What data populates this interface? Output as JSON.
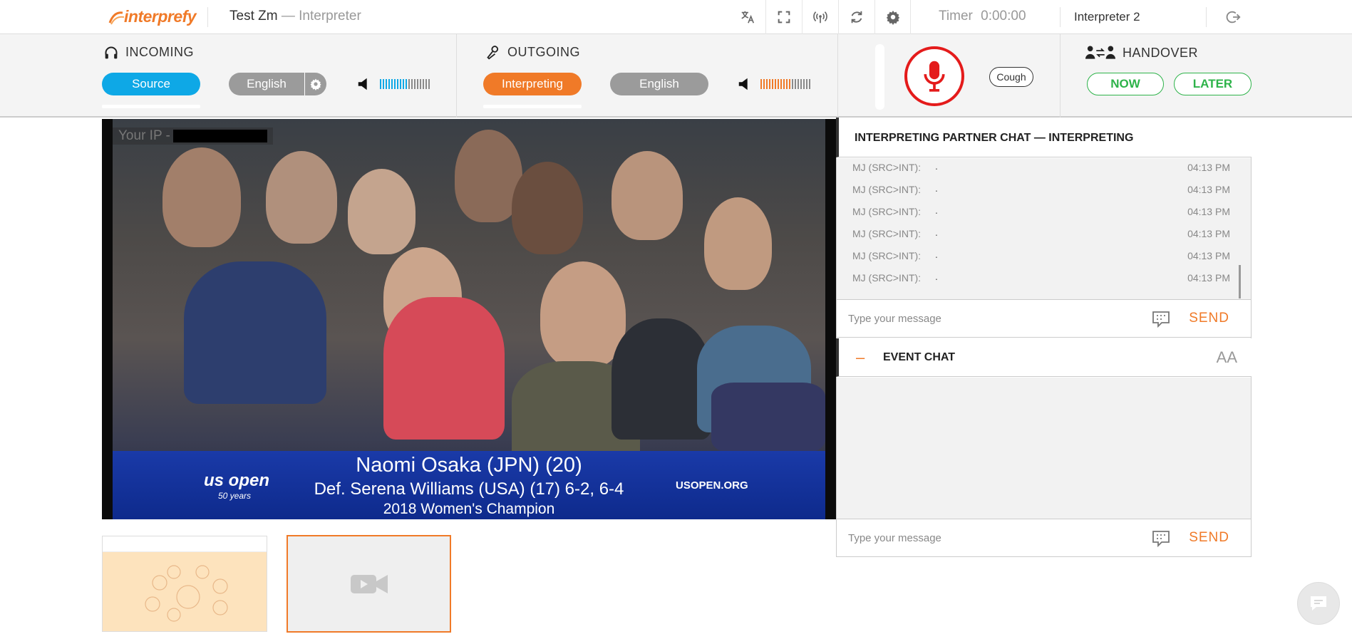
{
  "app": {
    "brand": "interprefy",
    "title": "Test Zm",
    "subtitle": "— Interpreter",
    "timer_label": "Timer",
    "timer_value": "0:00:00",
    "user": "Interpreter 2"
  },
  "toolbar": {
    "icons": [
      "translate-icon",
      "fullscreen-icon",
      "broadcast-icon",
      "refresh-icon",
      "gear-icon"
    ],
    "logout_icon": "logout-icon"
  },
  "incoming": {
    "title": "INCOMING",
    "source_label": "Source",
    "language": "English",
    "meter_level": 0.55
  },
  "outgoing": {
    "title": "OUTGOING",
    "interpreting_label": "Interpreting",
    "language": "English",
    "meter_level": 0.62
  },
  "controls": {
    "cough_label": "Cough"
  },
  "handover": {
    "title": "HANDOVER",
    "now_label": "NOW",
    "later_label": "LATER"
  },
  "video": {
    "ip_label": "Your IP -",
    "caption_line1": "Naomi Osaka (JPN) (20)",
    "caption_line2": "Def. Serena Williams (USA) (17) 6-2, 6-4",
    "caption_line3": "2018 Women's Champion",
    "brand_logo": "us open",
    "brand_years": "50 years",
    "site": "USOPEN.ORG"
  },
  "partner_chat": {
    "title": "INTERPRETING PARTNER CHAT — INTERPRETING",
    "messages": [
      {
        "sender": "MJ (SRC>INT):",
        "text": ".",
        "time": "04:13 PM"
      },
      {
        "sender": "MJ (SRC>INT):",
        "text": ".",
        "time": "04:13 PM"
      },
      {
        "sender": "MJ (SRC>INT):",
        "text": ".",
        "time": "04:13 PM"
      },
      {
        "sender": "MJ (SRC>INT):",
        "text": ".",
        "time": "04:13 PM"
      },
      {
        "sender": "MJ (SRC>INT):",
        "text": ".",
        "time": "04:13 PM"
      },
      {
        "sender": "MJ (SRC>INT):",
        "text": ".",
        "time": "04:13 PM"
      }
    ],
    "placeholder": "Type your message",
    "send_label": "SEND"
  },
  "event_chat": {
    "title": "EVENT CHAT",
    "minus": "–",
    "font_icon": "AA",
    "placeholder": "Type your message",
    "send_label": "SEND"
  },
  "colors": {
    "accent_orange": "#f07a28",
    "source_blue": "#0ea8e6",
    "mic_red": "#e41b1b",
    "handover_green": "#2eb34a"
  }
}
